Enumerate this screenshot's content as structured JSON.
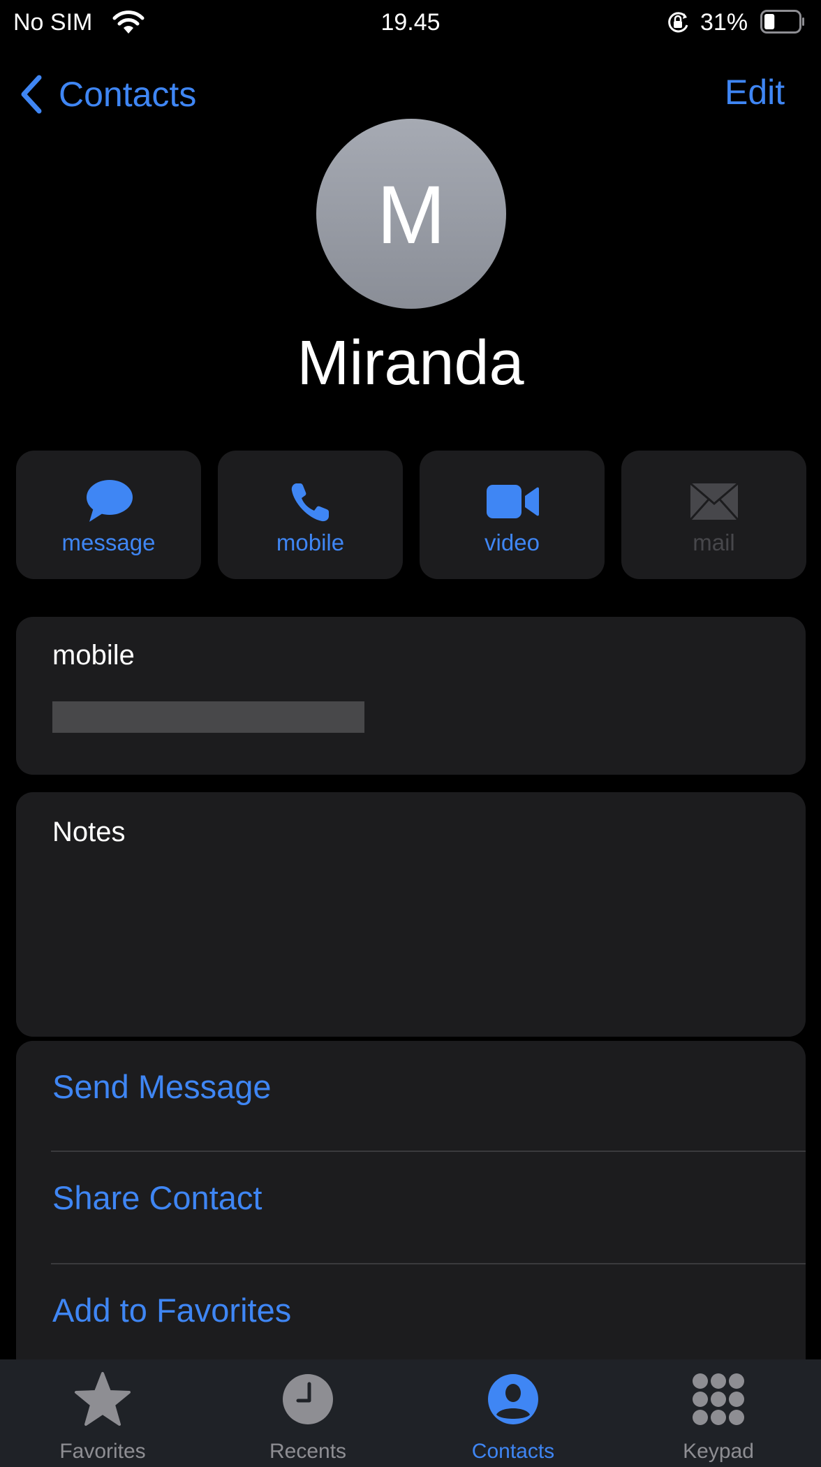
{
  "status_bar": {
    "carrier": "No SIM",
    "time": "19.45",
    "battery_percent": "31%",
    "battery_level": 0.31,
    "icons": [
      "wifi-icon",
      "rotation-lock-icon",
      "battery-icon"
    ]
  },
  "nav": {
    "back_label": "Contacts",
    "edit_label": "Edit"
  },
  "contact": {
    "initial": "M",
    "name": "Miranda"
  },
  "quick_actions": [
    {
      "label": "message",
      "icon": "message-bubble-icon",
      "enabled": true
    },
    {
      "label": "mobile",
      "icon": "phone-icon",
      "enabled": true
    },
    {
      "label": "video",
      "icon": "video-camera-icon",
      "enabled": true
    },
    {
      "label": "mail",
      "icon": "envelope-icon",
      "enabled": false
    }
  ],
  "phone": {
    "label": "mobile",
    "value_redacted": true
  },
  "notes": {
    "label": "Notes",
    "value": ""
  },
  "actions": [
    {
      "label": "Send Message"
    },
    {
      "label": "Share Contact"
    },
    {
      "label": "Add to Favorites"
    }
  ],
  "tabs": [
    {
      "label": "Favorites",
      "icon": "star-icon",
      "active": false
    },
    {
      "label": "Recents",
      "icon": "clock-icon",
      "active": false
    },
    {
      "label": "Contacts",
      "icon": "person-circle-icon",
      "active": true
    },
    {
      "label": "Keypad",
      "icon": "keypad-icon",
      "active": false
    }
  ],
  "colors": {
    "accent": "#3f86f4",
    "background": "#000000",
    "card": "#1c1c1e",
    "tab_inactive": "#8e8e93",
    "disabled": "#47474b"
  }
}
